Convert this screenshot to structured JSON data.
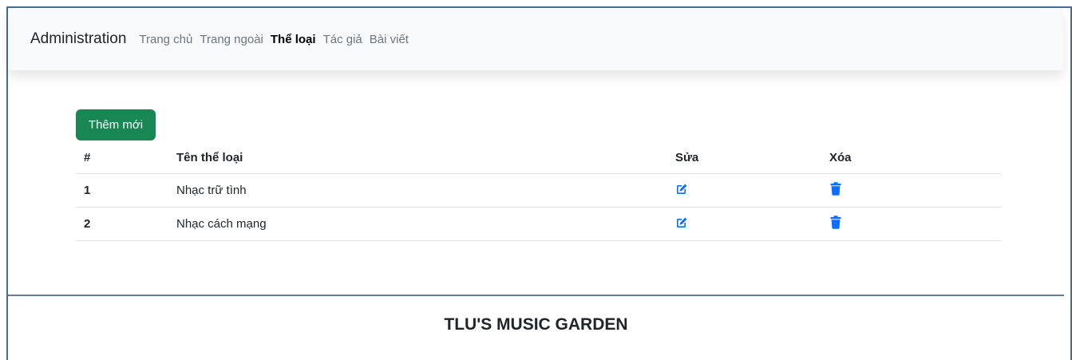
{
  "navbar": {
    "brand": "Administration",
    "links": [
      {
        "label": "Trang chủ",
        "active": false
      },
      {
        "label": "Trang ngoài",
        "active": false
      },
      {
        "label": "Thể loại",
        "active": true
      },
      {
        "label": "Tác giả",
        "active": false
      },
      {
        "label": "Bài viết",
        "active": false
      }
    ]
  },
  "add_button": {
    "label": "Thêm mới"
  },
  "table": {
    "headers": {
      "index": "#",
      "name": "Tên thể loại",
      "edit": "Sửa",
      "delete": "Xóa"
    },
    "rows": [
      {
        "index": "1",
        "name": "Nhạc trữ tình"
      },
      {
        "index": "2",
        "name": "Nhạc cách mạng"
      }
    ]
  },
  "icons": {
    "edit": "edit-pen-square-icon",
    "delete": "trash-icon"
  },
  "colors": {
    "accent": "#0d6efd",
    "success": "#198754"
  },
  "footer": {
    "title": "TLU'S MUSIC GARDEN"
  }
}
